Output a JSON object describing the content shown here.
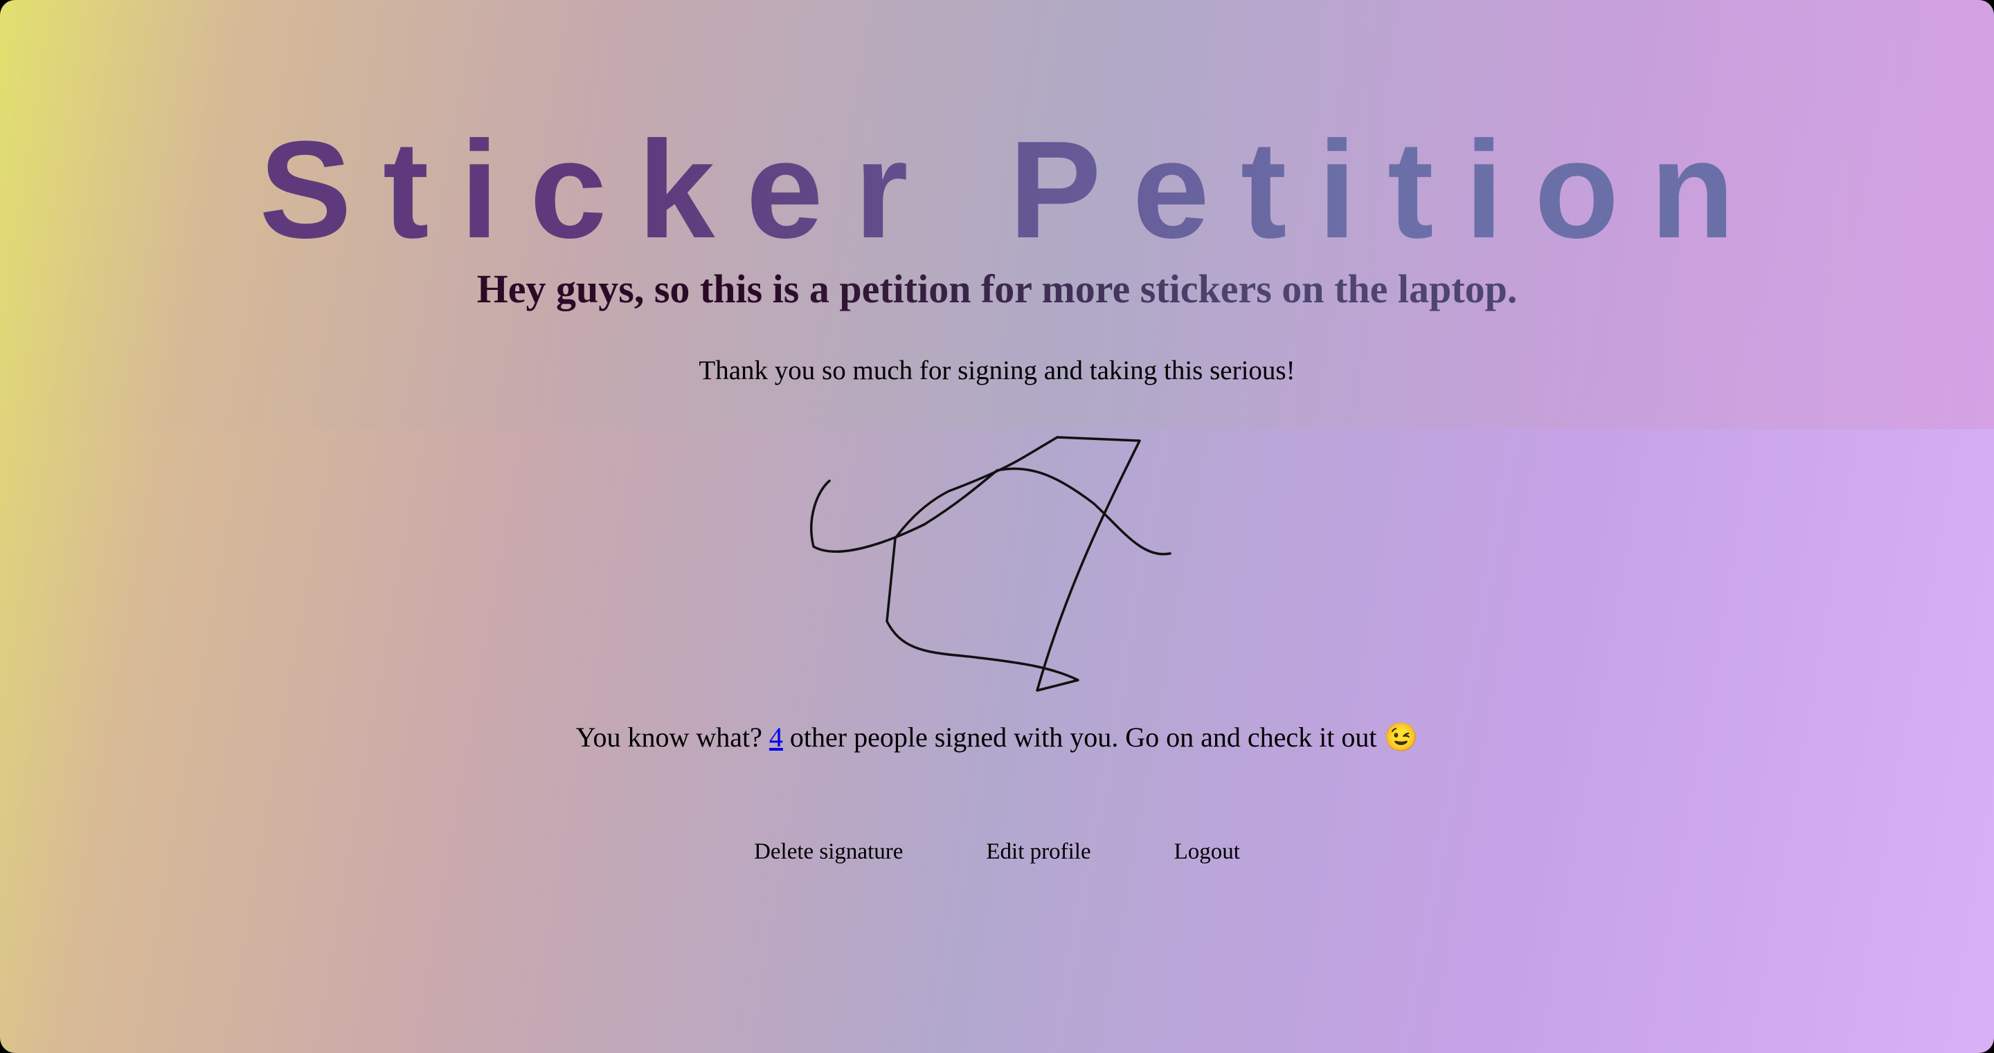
{
  "header": {
    "title": "Sticker Petition",
    "subtitle": "Hey guys, so this is a petition for more stickers on the laptop."
  },
  "main": {
    "thanks_message": "Thank you so much for signing and taking this serious!",
    "signers": {
      "prefix": "You know what?",
      "count": "4",
      "suffix": "other people signed with you. Go on and check it out",
      "emoji": "😉"
    }
  },
  "nav": {
    "delete_signature": "Delete signature",
    "edit_profile": "Edit profile",
    "logout": "Logout"
  },
  "icons": {
    "signature": "signature-drawing",
    "emoji": "winking-face-icon"
  },
  "colors": {
    "title": "#5e3a7c",
    "link": "#0000ee"
  }
}
